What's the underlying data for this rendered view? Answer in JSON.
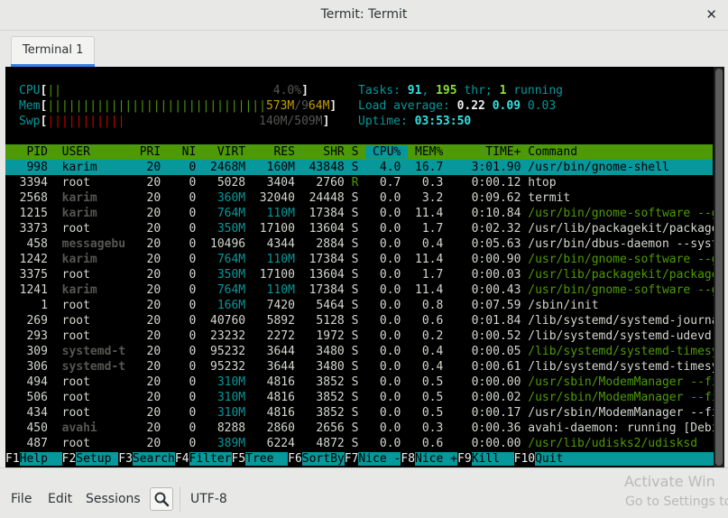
{
  "window": {
    "title": "Termit: Termit"
  },
  "tabs": [
    {
      "label": "Terminal 1"
    }
  ],
  "meters": {
    "cpu_label": "CPU",
    "cpu_bar": "||",
    "cpu_value": "4.0%",
    "mem_label": "Mem",
    "mem_bar": "|||||||||||||||||||||||||||||||",
    "mem_value_used": "573M",
    "mem_value_sep": "/9",
    "mem_value_total": "64M",
    "swp_label": "Swp",
    "swp_bar": "|||||||||||",
    "swp_value": "140M/509M",
    "tasks_label": "Tasks: ",
    "tasks_count": "91",
    "tasks_sep": ", ",
    "threads_count": "195",
    "threads_label": " thr; ",
    "running_count": "1",
    "running_label": " running",
    "load_label": "Load average: ",
    "load1": "0.22",
    "load5": "0.09",
    "load15": "0.03",
    "uptime_label": "Uptime: ",
    "uptime_value": "03:53:50"
  },
  "process_table": {
    "columns": [
      "PID",
      "USER",
      "PRI",
      "NI",
      "VIRT",
      "RES",
      "SHR",
      "S",
      "CPU%",
      "MEM%",
      "TIME+",
      "Command"
    ],
    "rows": [
      {
        "pid": "998",
        "user": "karim",
        "pri": "20",
        "ni": "0",
        "virt": "2468M",
        "res": "160M",
        "shr": "43848",
        "s": "S",
        "cpu": "4.0",
        "mem": "16.7",
        "time": "3:01.90",
        "cmd": "/usr/bin/gnome-shell"
      },
      {
        "pid": "3394",
        "user": "root",
        "pri": "20",
        "ni": "0",
        "virt": "5028",
        "res": "3404",
        "shr": "2760",
        "s": "R",
        "cpu": "0.7",
        "mem": "0.3",
        "time": "0:00.12",
        "cmd": "htop"
      },
      {
        "pid": "2568",
        "user": "karim",
        "pri": "20",
        "ni": "0",
        "virt": "360M",
        "res": "32040",
        "shr": "24448",
        "s": "S",
        "cpu": "0.0",
        "mem": "3.2",
        "time": "0:09.62",
        "cmd": "termit"
      },
      {
        "pid": "1215",
        "user": "karim",
        "pri": "20",
        "ni": "0",
        "virt": "764M",
        "res": "110M",
        "shr": "17384",
        "s": "S",
        "cpu": "0.0",
        "mem": "11.4",
        "time": "0:10.84",
        "cmd": "/usr/bin/gnome-software --gapplica"
      },
      {
        "pid": "3373",
        "user": "root",
        "pri": "20",
        "ni": "0",
        "virt": "350M",
        "res": "17100",
        "shr": "13604",
        "s": "S",
        "cpu": "0.0",
        "mem": "1.7",
        "time": "0:02.32",
        "cmd": "/usr/lib/packagekit/packagekitd"
      },
      {
        "pid": "458",
        "user": "messagebu",
        "pri": "20",
        "ni": "0",
        "virt": "10496",
        "res": "4344",
        "shr": "2884",
        "s": "S",
        "cpu": "0.0",
        "mem": "0.4",
        "time": "0:05.63",
        "cmd": "/usr/bin/dbus-daemon --system --ad"
      },
      {
        "pid": "1242",
        "user": "karim",
        "pri": "20",
        "ni": "0",
        "virt": "764M",
        "res": "110M",
        "shr": "17384",
        "s": "S",
        "cpu": "0.0",
        "mem": "11.4",
        "time": "0:00.90",
        "cmd": "/usr/bin/gnome-software --gapplica"
      },
      {
        "pid": "3375",
        "user": "root",
        "pri": "20",
        "ni": "0",
        "virt": "350M",
        "res": "17100",
        "shr": "13604",
        "s": "S",
        "cpu": "0.0",
        "mem": "1.7",
        "time": "0:00.03",
        "cmd": "/usr/lib/packagekit/packagekitd"
      },
      {
        "pid": "1241",
        "user": "karim",
        "pri": "20",
        "ni": "0",
        "virt": "764M",
        "res": "110M",
        "shr": "17384",
        "s": "S",
        "cpu": "0.0",
        "mem": "11.4",
        "time": "0:00.43",
        "cmd": "/usr/bin/gnome-software --gapplica"
      },
      {
        "pid": "1",
        "user": "root",
        "pri": "20",
        "ni": "0",
        "virt": "166M",
        "res": "7420",
        "shr": "5464",
        "s": "S",
        "cpu": "0.0",
        "mem": "0.8",
        "time": "0:07.59",
        "cmd": "/sbin/init"
      },
      {
        "pid": "269",
        "user": "root",
        "pri": "20",
        "ni": "0",
        "virt": "40760",
        "res": "5892",
        "shr": "5128",
        "s": "S",
        "cpu": "0.0",
        "mem": "0.6",
        "time": "0:01.84",
        "cmd": "/lib/systemd/systemd-journald"
      },
      {
        "pid": "293",
        "user": "root",
        "pri": "20",
        "ni": "0",
        "virt": "23232",
        "res": "2272",
        "shr": "1972",
        "s": "S",
        "cpu": "0.0",
        "mem": "0.2",
        "time": "0:00.52",
        "cmd": "/lib/systemd/systemd-udevd"
      },
      {
        "pid": "309",
        "user": "systemd-t",
        "pri": "20",
        "ni": "0",
        "virt": "95232",
        "res": "3644",
        "shr": "3480",
        "s": "S",
        "cpu": "0.0",
        "mem": "0.4",
        "time": "0:00.05",
        "cmd": "/lib/systemd/systemd-timesyncd"
      },
      {
        "pid": "306",
        "user": "systemd-t",
        "pri": "20",
        "ni": "0",
        "virt": "95232",
        "res": "3644",
        "shr": "3480",
        "s": "S",
        "cpu": "0.0",
        "mem": "0.4",
        "time": "0:00.61",
        "cmd": "/lib/systemd/systemd-timesyncd"
      },
      {
        "pid": "494",
        "user": "root",
        "pri": "20",
        "ni": "0",
        "virt": "310M",
        "res": "4816",
        "shr": "3852",
        "s": "S",
        "cpu": "0.0",
        "mem": "0.5",
        "time": "0:00.00",
        "cmd": "/usr/sbin/ModemManager --filter-po"
      },
      {
        "pid": "506",
        "user": "root",
        "pri": "20",
        "ni": "0",
        "virt": "310M",
        "res": "4816",
        "shr": "3852",
        "s": "S",
        "cpu": "0.0",
        "mem": "0.5",
        "time": "0:00.02",
        "cmd": "/usr/sbin/ModemManager --filter-po"
      },
      {
        "pid": "434",
        "user": "root",
        "pri": "20",
        "ni": "0",
        "virt": "310M",
        "res": "4816",
        "shr": "3852",
        "s": "S",
        "cpu": "0.0",
        "mem": "0.5",
        "time": "0:00.17",
        "cmd": "/usr/sbin/ModemManager --filter-po"
      },
      {
        "pid": "450",
        "user": "avahi",
        "pri": "20",
        "ni": "0",
        "virt": "8288",
        "res": "2860",
        "shr": "2656",
        "s": "S",
        "cpu": "0.0",
        "mem": "0.3",
        "time": "0:00.36",
        "cmd": "avahi-daemon: running [Debian.loca"
      },
      {
        "pid": "487",
        "user": "root",
        "pri": "20",
        "ni": "0",
        "virt": "389M",
        "res": "6224",
        "shr": "4872",
        "s": "S",
        "cpu": "0.0",
        "mem": "0.6",
        "time": "0:00.00",
        "cmd": "/usr/lib/udisks2/udisksd"
      }
    ]
  },
  "function_keys": [
    {
      "key": "F1",
      "label": "Help  "
    },
    {
      "key": "F2",
      "label": "Setup "
    },
    {
      "key": "F3",
      "label": "Search"
    },
    {
      "key": "F4",
      "label": "Filter"
    },
    {
      "key": "F5",
      "label": "Tree  "
    },
    {
      "key": "F6",
      "label": "SortBy"
    },
    {
      "key": "F7",
      "label": "Nice -"
    },
    {
      "key": "F8",
      "label": "Nice +"
    },
    {
      "key": "F9",
      "label": "Kill  "
    },
    {
      "key": "F10",
      "label": "Quit                          "
    }
  ],
  "statusbar": {
    "file": "File",
    "edit": "Edit",
    "sessions": "Sessions",
    "encoding": "UTF-8"
  },
  "watermark": {
    "line1": "Activate Win",
    "line2": "Go to Settings to"
  }
}
